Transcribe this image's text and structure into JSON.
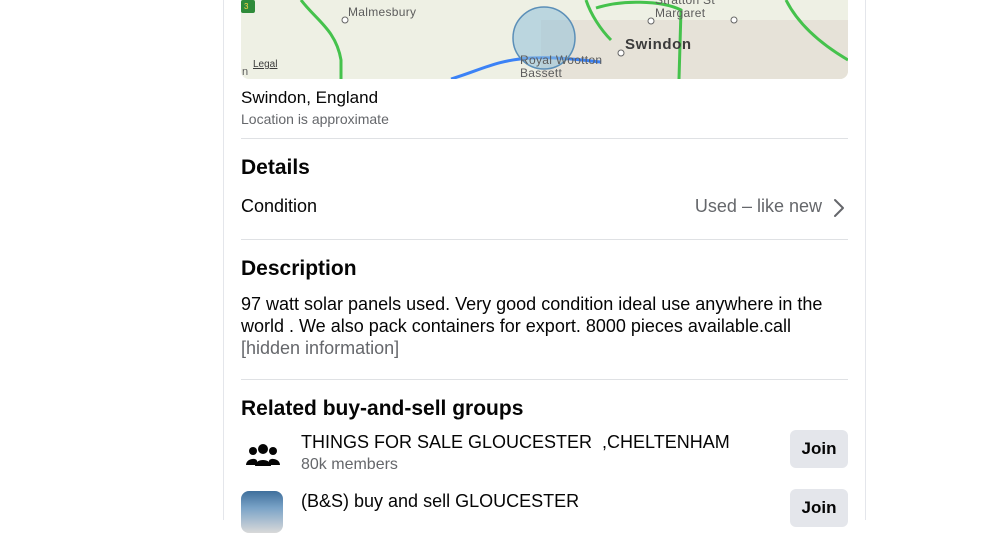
{
  "map": {
    "labels": {
      "malmesbury": "Malmesbury",
      "stratton": "Stratton St\nMargaret",
      "swindon": "Swindon",
      "royal_wootton": "Royal Wootton\nBassett",
      "edge_n": "n"
    },
    "legal_label": "Legal",
    "road_shield": "3"
  },
  "location": {
    "city": "Swindon, England",
    "note": "Location is approximate"
  },
  "details": {
    "heading": "Details",
    "condition_label": "Condition",
    "condition_value": "Used – like new"
  },
  "description": {
    "heading": "Description",
    "text": "97 watt solar panels used. Very good condition ideal use anywhere in the world . We also pack containers for export. 8000 pieces available.call",
    "hidden": "[hidden information]"
  },
  "related": {
    "heading": "Related buy-and-sell groups",
    "groups": [
      {
        "name": "THINGS FOR SALE GLOUCESTER  ,CHELTENHAM",
        "members": "80k members",
        "join_label": "Join",
        "icon": "group-people-icon"
      },
      {
        "name": "(B&S) buy and sell GLOUCESTER",
        "members": "",
        "join_label": "Join",
        "icon": "group-thumbnail"
      }
    ]
  }
}
